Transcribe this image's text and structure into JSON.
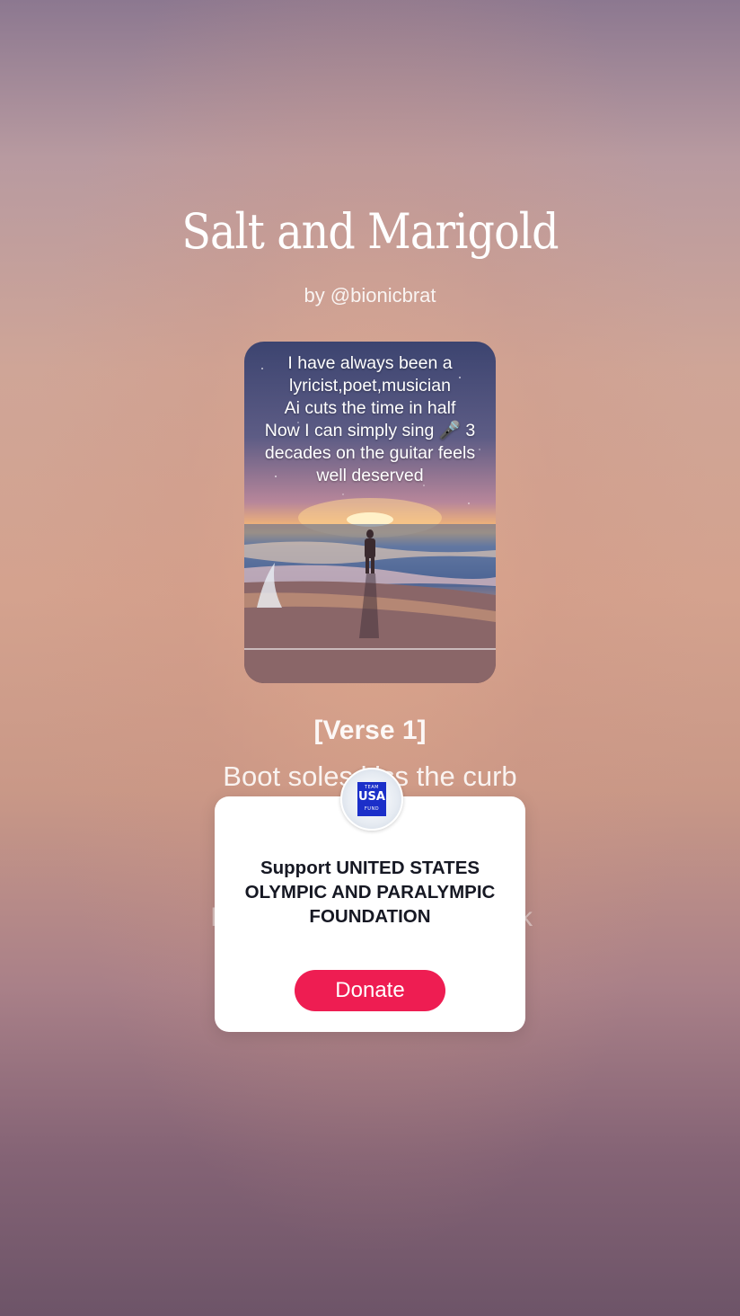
{
  "song": {
    "title": "Salt and Marigold",
    "byline": "by @bionicbrat"
  },
  "cover": {
    "caption": "I have always been a\nlyricist,poet,musician\nAi cuts the time in half\nNow I can simply sing 🎤 3\ndecades on the guitar feels\nwell deserved",
    "progress": 0
  },
  "lyrics": {
    "section": "[Verse 1]",
    "current_line": "Boot soles kiss the curb",
    "next_line_start": "I",
    "next_line_end": "k"
  },
  "donation_popup": {
    "logo_small_top": "TEAM",
    "logo_big": "USA",
    "logo_small_bottom": "FUND",
    "title": "Support UNITED STATES OLYMPIC AND PARALYMPIC FOUNDATION",
    "button_label": "Donate"
  },
  "colors": {
    "donate_button": "#ee1d52",
    "logo_badge": "#1b2fc9"
  }
}
